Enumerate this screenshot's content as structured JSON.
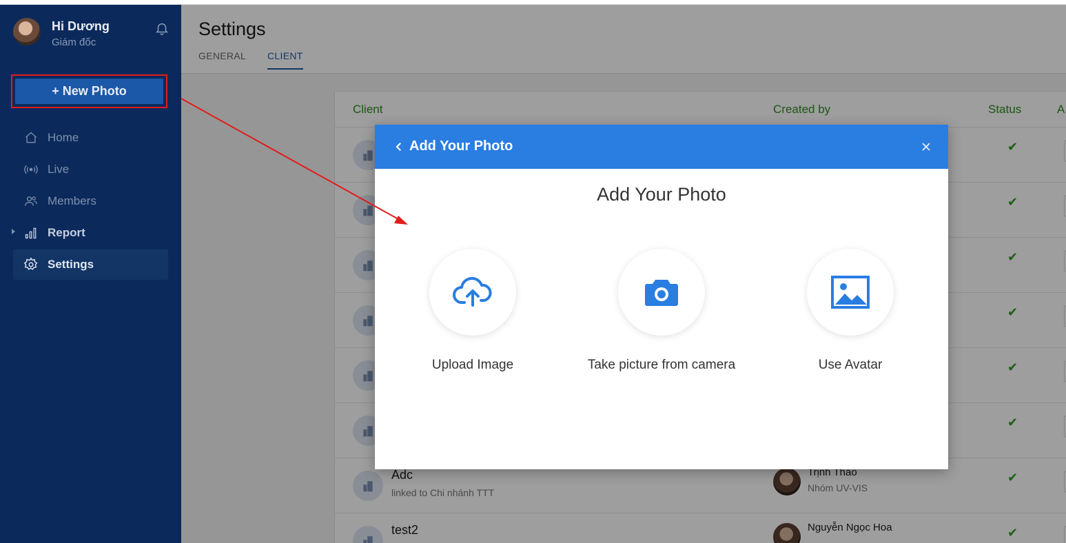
{
  "user": {
    "name": "Hi Dương",
    "role": "Giám đốc"
  },
  "sidebar": {
    "new_photo_label": "+ New Photo",
    "items": [
      {
        "label": "Home",
        "icon": "home-icon"
      },
      {
        "label": "Live",
        "icon": "broadcast-icon"
      },
      {
        "label": "Members",
        "icon": "members-icon"
      },
      {
        "label": "Report",
        "icon": "bar-chart-icon"
      },
      {
        "label": "Settings",
        "icon": "gear-icon"
      }
    ]
  },
  "header": {
    "title": "Settings",
    "tabs": [
      {
        "label": "GENERAL"
      },
      {
        "label": "CLIENT"
      }
    ]
  },
  "table": {
    "columns": {
      "client": "Client",
      "created_by": "Created by",
      "status": "Status",
      "action": "A"
    },
    "rows": [
      {
        "name": "Adc",
        "sub": "linked to Chi nhánh TTT",
        "creator": "Trịnh Thảo",
        "group": "Nhóm UV-VIS",
        "status": "✔"
      },
      {
        "name": "test2",
        "sub": "",
        "creator": "Nguyễn Ngọc Hoa",
        "group": "",
        "status": "✔"
      }
    ],
    "status_mark": "✔"
  },
  "modal": {
    "header_title": "Add Your Photo",
    "heading": "Add Your Photo",
    "options": [
      {
        "label": "Upload Image",
        "icon": "cloud-upload-icon"
      },
      {
        "label": "Take picture from camera",
        "icon": "camera-icon"
      },
      {
        "label": "Use Avatar",
        "icon": "image-icon"
      }
    ]
  },
  "colors": {
    "sidebar": "#0b2a5b",
    "modal_header": "#2a7de1",
    "accent_green": "#2e8b1f",
    "annotation": "#e21b1b"
  }
}
